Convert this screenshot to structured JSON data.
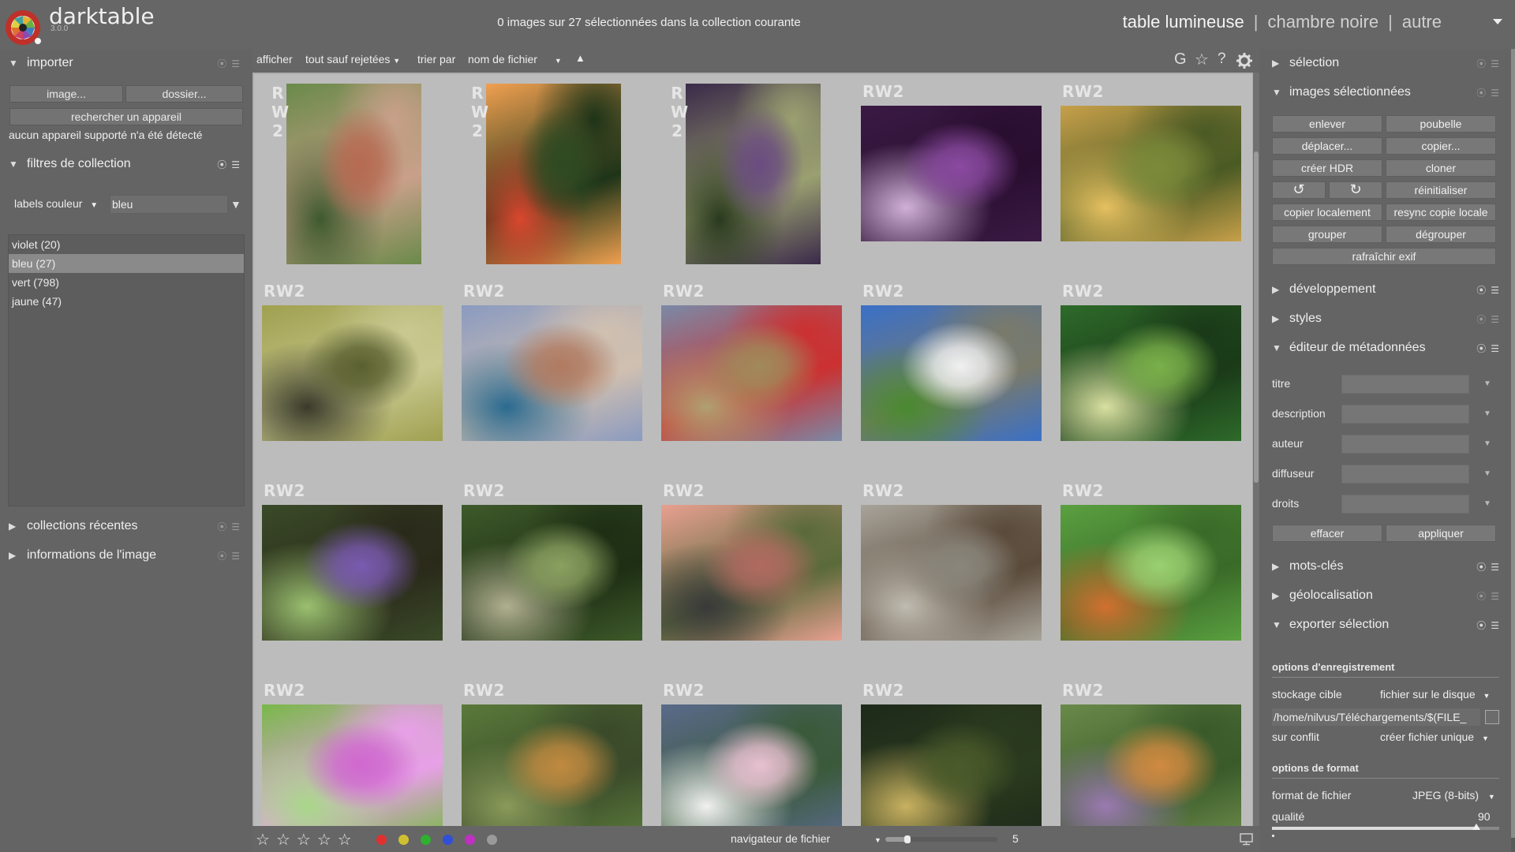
{
  "header": {
    "app_name": "darktable",
    "version": "3.0.0",
    "selection_status": "0 images sur 27 sélectionnées dans la collection courante",
    "views": [
      "table lumineuse",
      "chambre noire",
      "autre"
    ],
    "view_separator": "|"
  },
  "left": {
    "importer": {
      "title": "importer",
      "image_btn": "image...",
      "folder_btn": "dossier...",
      "device_btn": "rechercher un appareil",
      "no_device": "aucun appareil supporté n'a été détecté"
    },
    "collection_filters": {
      "title": "filtres de collection",
      "property": "labels couleur",
      "query": "bleu",
      "items": [
        "violet (20)",
        "bleu (27)",
        "vert (798)",
        "jaune (47)"
      ]
    },
    "recent_collections": {
      "title": "collections récentes"
    },
    "image_info": {
      "title": "informations de l'image"
    }
  },
  "toolbar": {
    "show_label": "afficher",
    "show_value": "tout sauf rejetées",
    "sort_label": "trier par",
    "sort_value": "nom de fichier",
    "sort_dir_glyph": "▲",
    "grouping_glyph": "G",
    "star_glyph": "☆",
    "help_glyph": "?"
  },
  "grid": {
    "format_label": "RW2",
    "images": [
      {
        "colors": [
          "#6a8a4a",
          "#b66a52",
          "#3e5a2e",
          "#c9a08a"
        ]
      },
      {
        "colors": [
          "#f0a050",
          "#2e4a22",
          "#d9472e",
          "#1e3418"
        ]
      },
      {
        "colors": [
          "#3a2a4a",
          "#6a4c80",
          "#2a3a1e",
          "#9aa070"
        ]
      },
      {
        "colors": [
          "#3a1a44",
          "#8a4aa0",
          "#d0b0d8",
          "#2a0e30"
        ]
      },
      {
        "colors": [
          "#c7a04a",
          "#7a8a3a",
          "#e6c060",
          "#4a5a24"
        ]
      },
      {
        "colors": [
          "#a0a050",
          "#5a6030",
          "#3a3a2a",
          "#c8c890"
        ]
      },
      {
        "colors": [
          "#8a9ac0",
          "#b07a60",
          "#2a6a90",
          "#d0c0b0"
        ]
      },
      {
        "colors": [
          "#7a8aa8",
          "#a08a5a",
          "#b0a070",
          "#cc3030"
        ]
      },
      {
        "colors": [
          "#3a70c8",
          "#f0f0f0",
          "#4a8a30",
          "#7a7a6a"
        ]
      },
      {
        "colors": [
          "#2e6a2a",
          "#7ab04a",
          "#d8e0a0",
          "#1a3a18"
        ]
      },
      {
        "colors": [
          "#3a4a28",
          "#7a5ab0",
          "#9ac070",
          "#2a2a1a"
        ]
      },
      {
        "colors": [
          "#3e5a2a",
          "#8aa060",
          "#b0b090",
          "#1e2e14"
        ]
      },
      {
        "colors": [
          "#e8a090",
          "#b06a60",
          "#3a3a3a",
          "#5a6a3a"
        ]
      },
      {
        "colors": [
          "#a8a49a",
          "#8a867c",
          "#c0bcb2",
          "#5a4a3a"
        ]
      },
      {
        "colors": [
          "#5aa040",
          "#9ad070",
          "#d07030",
          "#3a6a28"
        ]
      },
      {
        "colors": [
          "#78b848",
          "#d068d0",
          "#a8d888",
          "#e8a0e8"
        ]
      },
      {
        "colors": [
          "#5a7a3a",
          "#c08a40",
          "#8a9a5a",
          "#3a4a2a"
        ]
      },
      {
        "colors": [
          "#5a6a8a",
          "#e8c0d0",
          "#f0f0f0",
          "#3a5a3a"
        ]
      },
      {
        "colors": [
          "#1e2a1a",
          "#4a5a2a",
          "#c8b060",
          "#2a3a1e"
        ]
      },
      {
        "colors": [
          "#6a8a4a",
          "#d08a40",
          "#9a7ab0",
          "#3a5a2a"
        ]
      }
    ]
  },
  "bottom": {
    "stars": [
      "☆",
      "☆",
      "☆",
      "☆",
      "☆"
    ],
    "labels": [
      "#e03030",
      "#d0c030",
      "#30b030",
      "#3050d8",
      "#c030c0",
      "#9a9a9a"
    ],
    "navigator_label": "navigateur de fichier",
    "zoom_value": "5",
    "zoom_fraction": 0.2
  },
  "right": {
    "selection": {
      "title": "sélection"
    },
    "selected_images": {
      "title": "images sélectionnées",
      "buttons": [
        "enlever",
        "poubelle",
        "déplacer...",
        "copier...",
        "créer HDR",
        "cloner",
        "↺",
        "↻",
        "réinitialiser",
        "copier localement",
        "resync copie locale",
        "grouper",
        "dégrouper"
      ],
      "refresh_exif": "rafraîchir exif"
    },
    "development": {
      "title": "développement"
    },
    "styles": {
      "title": "styles"
    },
    "metadata_editor": {
      "title": "éditeur de métadonnées",
      "fields": [
        "titre",
        "description",
        "auteur",
        "diffuseur",
        "droits"
      ],
      "clear_btn": "effacer",
      "apply_btn": "appliquer"
    },
    "keywords": {
      "title": "mots-clés"
    },
    "geotagging": {
      "title": "géolocalisation"
    },
    "export": {
      "title": "exporter sélection",
      "storage_options": "options d'enregistrement",
      "target_storage_label": "stockage cible",
      "target_storage_value": "fichier sur le disque",
      "path": "/home/nilvus/Téléchargements/$(FILE_",
      "on_conflict_label": "sur conflit",
      "on_conflict_value": "créer fichier unique",
      "format_options": "options de format",
      "file_format_label": "format de fichier",
      "file_format_value": "JPEG (8-bits)",
      "quality_label": "qualité",
      "quality_value": "90",
      "quality_fraction": 0.9
    }
  },
  "colors": {
    "panel_bg": "#646464",
    "grid_bg": "#adadad",
    "cell_bg": "#bcbcbc"
  }
}
